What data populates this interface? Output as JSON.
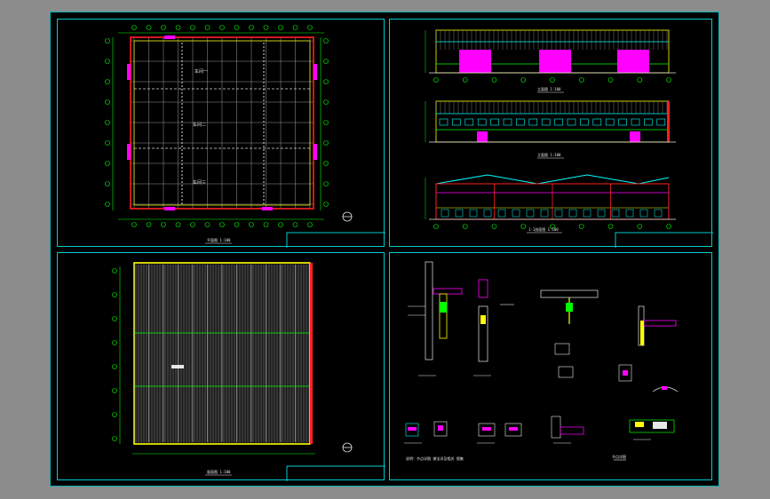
{
  "window": {
    "title": ""
  },
  "sheet": {
    "background": "#000000",
    "frame_color": "#00cccc",
    "frame_outer_color": "#00b4b4"
  },
  "colors": {
    "yellow": "#ffff00",
    "green": "#00ff00",
    "red": "#ff2020",
    "magenta": "#ff00ff",
    "cyan": "#00ffff",
    "white": "#e8e8e8"
  },
  "views": {
    "floor_plan": {
      "caption": "平面图 1:100"
    },
    "elevation_a": {
      "caption": "立面图 1:100"
    },
    "elevation_b": {
      "caption": "立面图 1:100"
    },
    "section": {
      "caption": "1-1剖面图 1:100"
    },
    "roof_plan": {
      "caption": "屋面图 1:100"
    },
    "details": {
      "caption": "节点详图",
      "note": "说明：节点详图 做法详见相关 图集"
    }
  },
  "icons": [
    "north-arrow-icon",
    "north-arrow-icon"
  ]
}
